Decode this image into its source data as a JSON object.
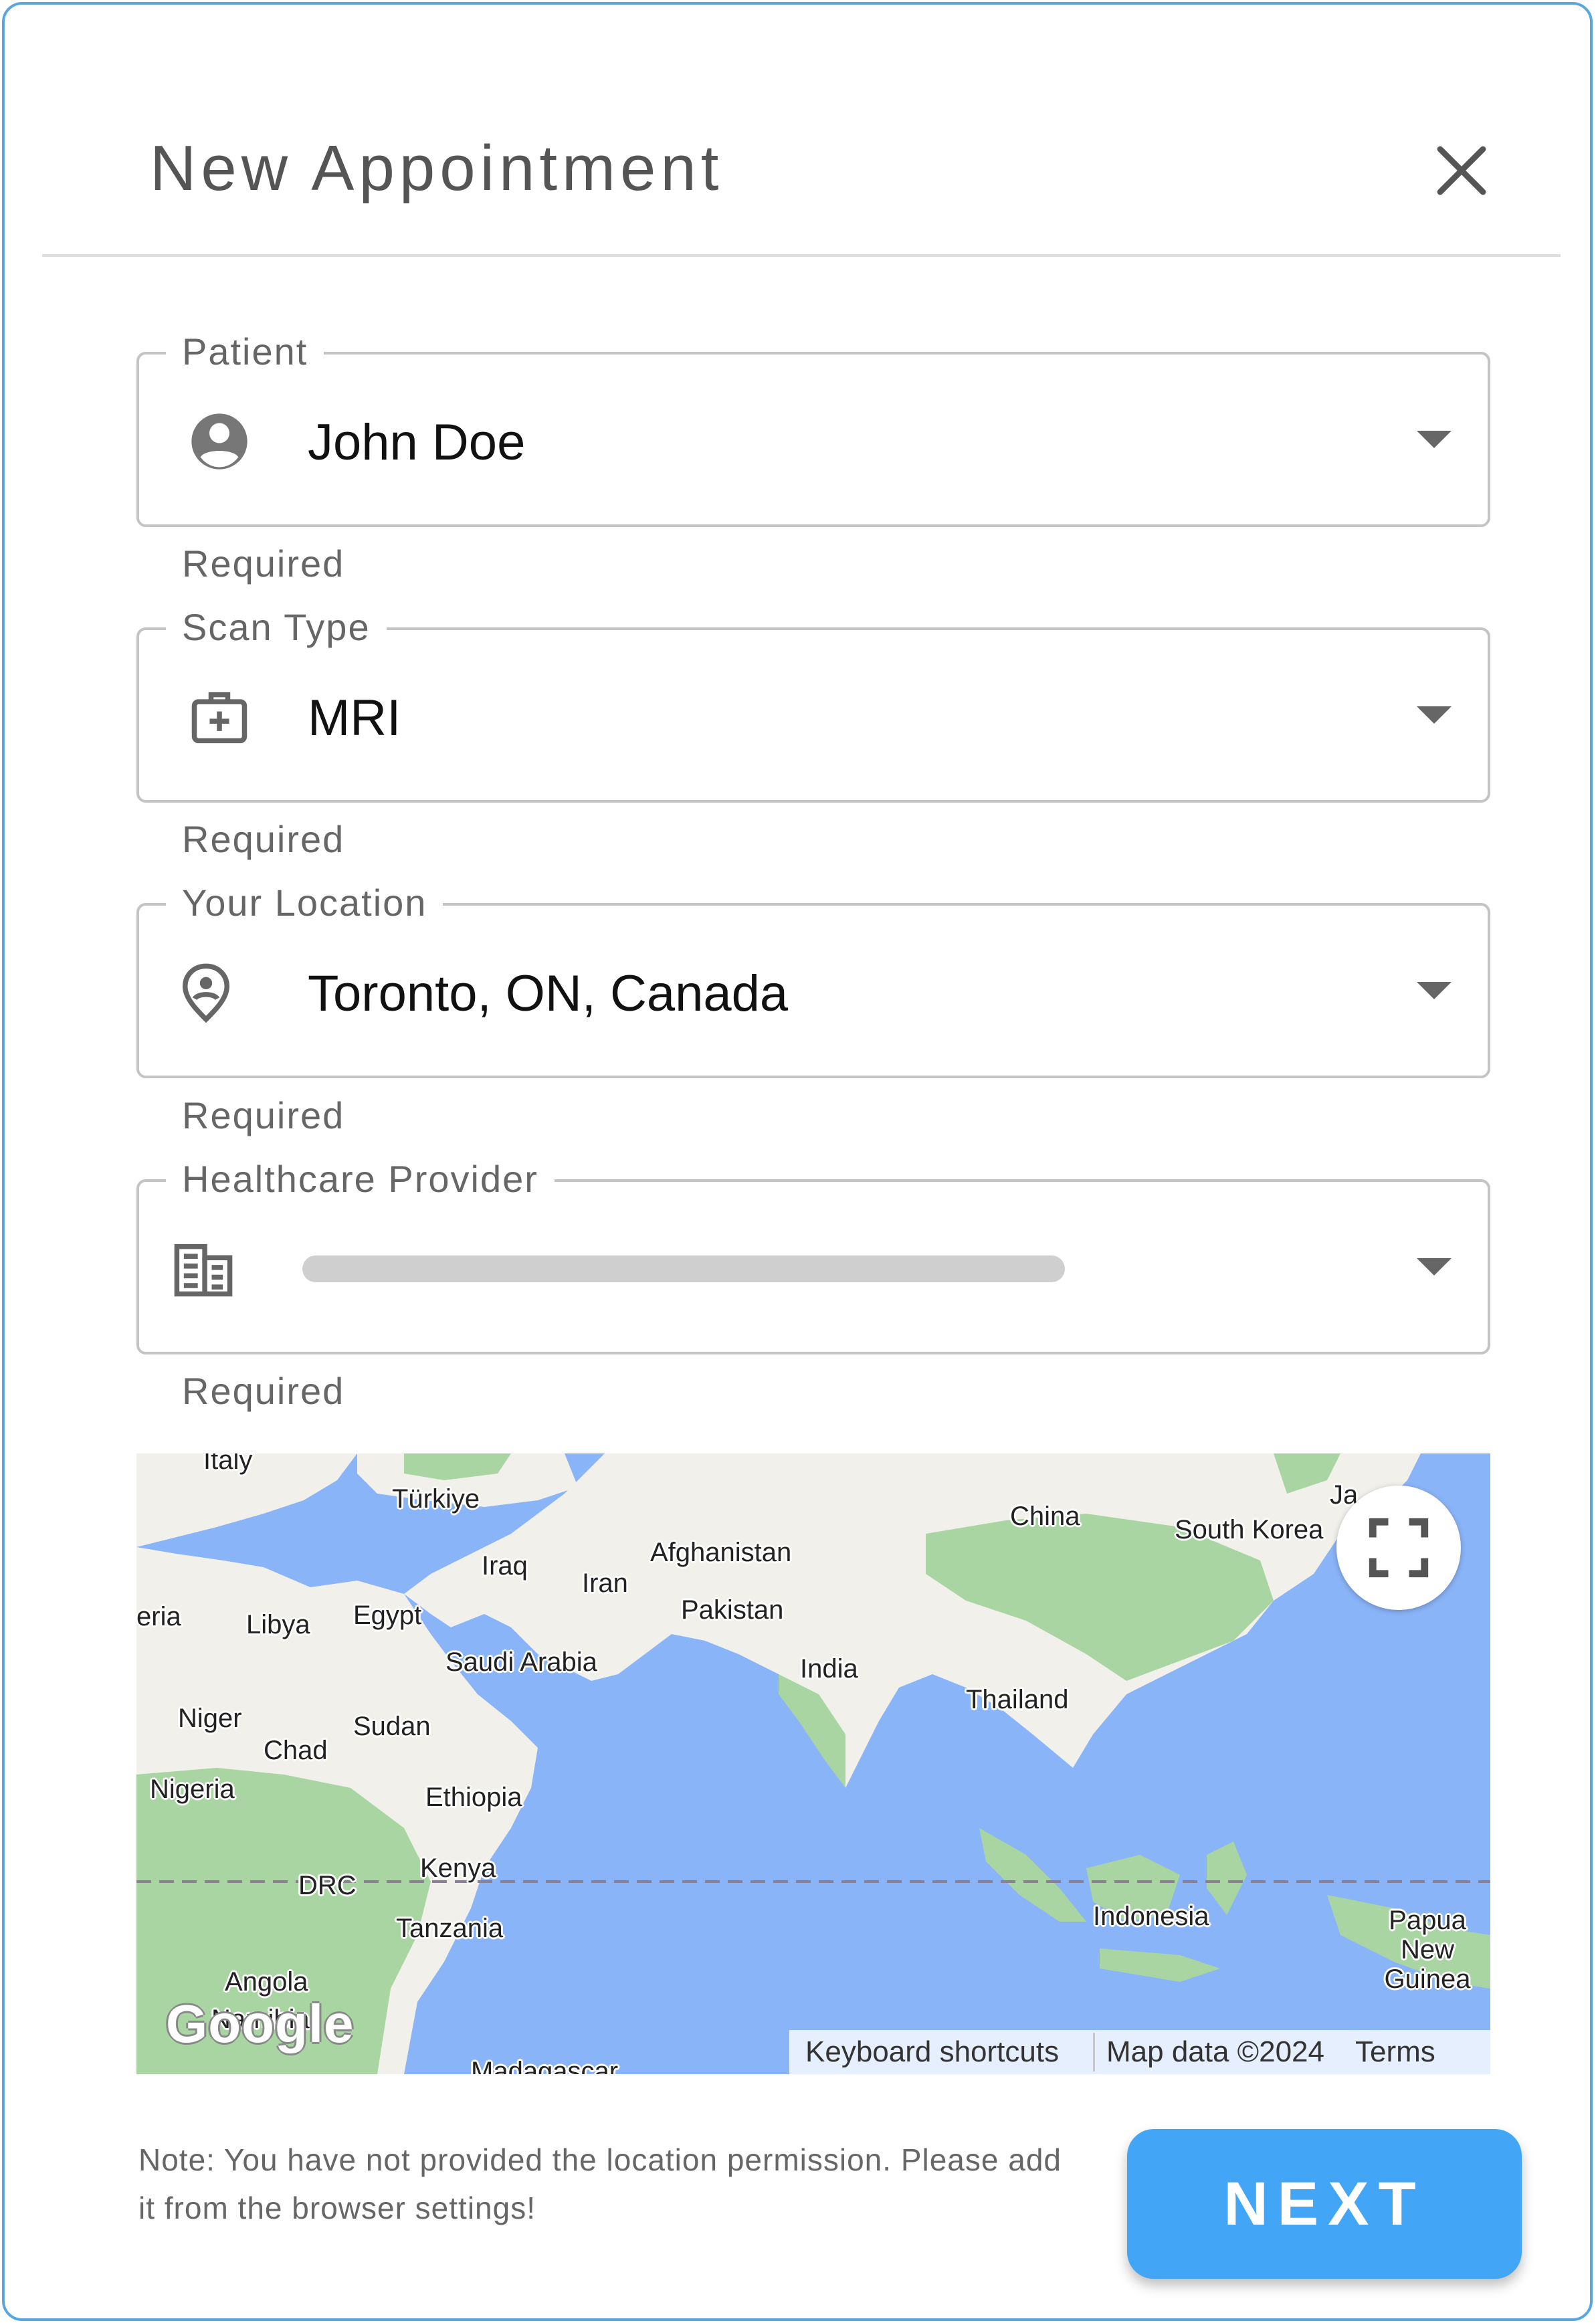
{
  "dialog": {
    "title": "New Appointment",
    "close_icon": "close-icon"
  },
  "fields": {
    "patient": {
      "label": "Patient",
      "value": "John Doe",
      "helper": "Required",
      "icon": "account-circle-icon"
    },
    "scan_type": {
      "label": "Scan Type",
      "value": "MRI",
      "helper": "Required",
      "icon": "medical-bag-icon"
    },
    "location": {
      "label": "Your Location",
      "value": "Toronto, ON, Canada",
      "helper": "Required",
      "icon": "person-pin-icon"
    },
    "provider": {
      "label": "Healthcare Provider",
      "value": "",
      "helper": "Required",
      "icon": "building-icon",
      "loading": true
    }
  },
  "map": {
    "labels": {
      "italy": "Italy",
      "turkiye": "Türkiye",
      "iraq": "Iraq",
      "iran": "Iran",
      "afghanistan": "Afghanistan",
      "pakistan": "Pakistan",
      "china": "China",
      "south_korea": "South Korea",
      "japan": "Ja",
      "algeria": "eria",
      "libya": "Libya",
      "egypt": "Egypt",
      "saudi_arabia": "Saudi Arabia",
      "india": "India",
      "thailand": "Thailand",
      "niger": "Niger",
      "sudan": "Sudan",
      "chad": "Chad",
      "nigeria": "Nigeria",
      "ethiopia": "Ethiopia",
      "kenya": "Kenya",
      "drc": "DRC",
      "tanzania": "Tanzania",
      "indonesia": "Indonesia",
      "papua_new_guinea": "Papua New Guinea",
      "angola": "Angola",
      "namibia": "Namibia",
      "madagascar": "Madagascar"
    },
    "logo": "Google",
    "attribution": {
      "keyboard": "Keyboard shortcuts",
      "map_data": "Map data ©2024",
      "terms": "Terms"
    },
    "fullscreen_icon": "fullscreen-icon",
    "colors": {
      "water": "#8ab4f8",
      "land": "#f1f0ea",
      "vegetation": "#a8d5a2"
    }
  },
  "footer": {
    "note": "Note: You have not provided the location permission. Please add it from the browser settings!",
    "next_label": "NEXT"
  },
  "colors": {
    "accent": "#42a5f5",
    "border": "#5aa7e0"
  }
}
